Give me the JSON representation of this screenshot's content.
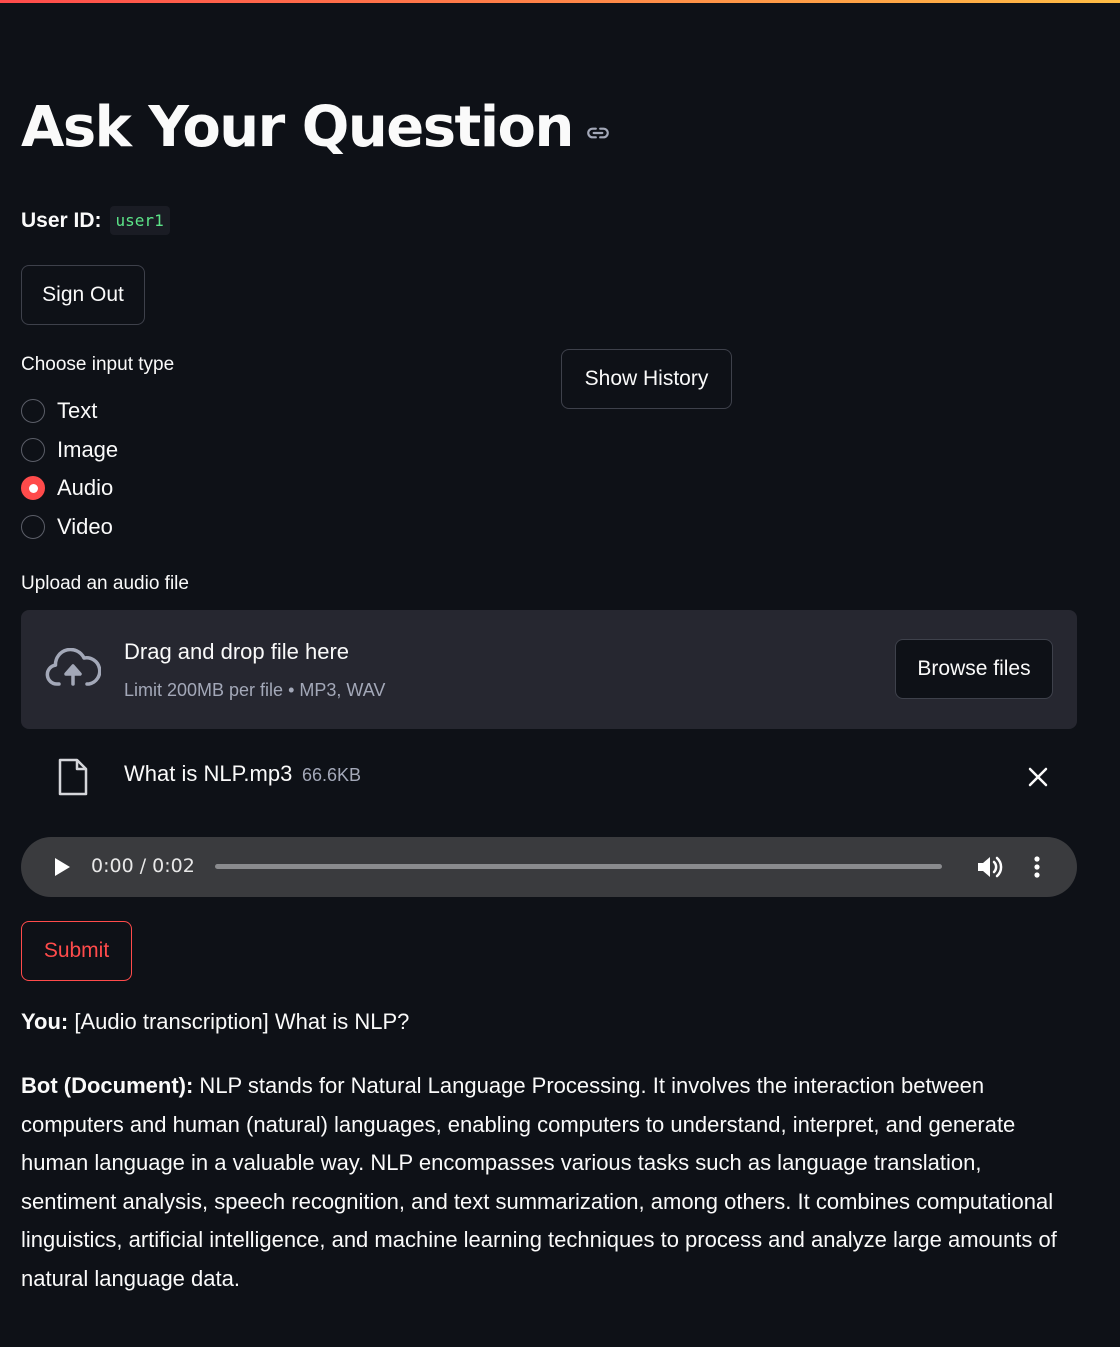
{
  "page": {
    "title": "Ask Your Question",
    "user_id_label": "User ID:",
    "user_id_value": "user1"
  },
  "buttons": {
    "sign_out": "Sign Out",
    "show_history": "Show History",
    "submit": "Submit",
    "browse_files": "Browse files"
  },
  "input_type": {
    "label": "Choose input type",
    "options": [
      "Text",
      "Image",
      "Audio",
      "Video"
    ],
    "selected": "Audio"
  },
  "upload": {
    "label": "Upload an audio file",
    "drop_title": "Drag and drop file here",
    "limit": "Limit 200MB per file • MP3, WAV"
  },
  "file": {
    "name": "What is NLP.mp3",
    "size": "66.6KB"
  },
  "audio_player": {
    "time": "0:00 / 0:02",
    "progress": 0
  },
  "conversation": {
    "you_label": "You:",
    "you_text": " [Audio transcription] What is NLP?",
    "bot_label": "Bot (Document):",
    "bot_text": " NLP stands for Natural Language Processing. It involves the interaction between computers and human (natural) languages, enabling computers to understand, interpret, and generate human language in a valuable way. NLP encompasses various tasks such as language translation, sentiment analysis, speech recognition, and text summarization, among others. It combines computational linguistics, artificial intelligence, and machine learning techniques to process and analyze large amounts of natural language data."
  },
  "colors": {
    "background": "#0e1117",
    "accent": "#ff4b4b",
    "code_text": "#5ce488",
    "dropzone": "#262730"
  }
}
